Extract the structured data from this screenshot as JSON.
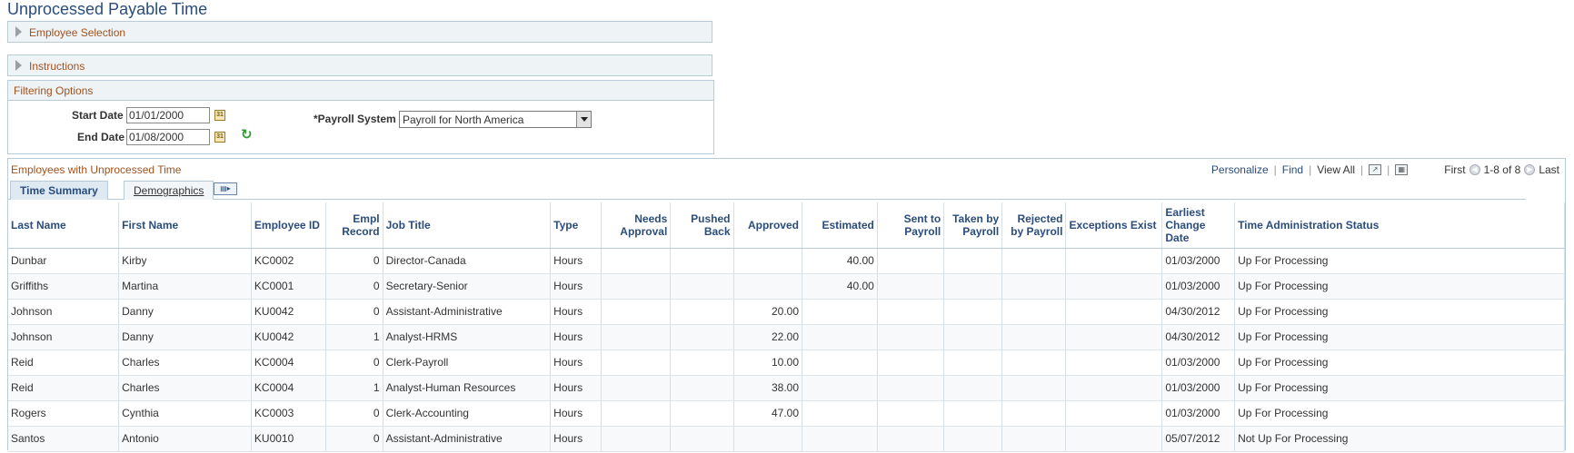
{
  "page": {
    "title": "Unprocessed Payable Time"
  },
  "sections": {
    "employee_selection": "Employee Selection",
    "instructions": "Instructions"
  },
  "filter": {
    "header": "Filtering Options",
    "start_date_label": "Start Date",
    "start_date": "01/01/2000",
    "end_date_label": "End Date",
    "end_date": "01/08/2000",
    "payroll_label": "*Payroll System",
    "payroll_value": "Payroll for North America"
  },
  "grid": {
    "title": "Employees with Unprocessed Time",
    "nav": {
      "personalize": "Personalize",
      "find": "Find",
      "view_all": "View All",
      "first": "First",
      "range": "1-8 of 8",
      "last": "Last"
    },
    "tabs": [
      "Time Summary",
      "Demographics"
    ],
    "columns": [
      "Last Name",
      "First Name",
      "Employee ID",
      "Empl Record",
      "Job Title",
      "Type",
      "Needs Approval",
      "Pushed Back",
      "Approved",
      "Estimated",
      "Sent to Payroll",
      "Taken by Payroll",
      "Rejected by Payroll",
      "Exceptions Exist",
      "Earliest Change Date",
      "Time Administration Status"
    ],
    "rows": [
      [
        "Dunbar",
        "Kirby",
        "KC0002",
        "0",
        "Director-Canada",
        "Hours",
        "",
        "",
        "",
        "40.00",
        "",
        "",
        "",
        "",
        "01/03/2000",
        "Up For Processing"
      ],
      [
        "Griffiths",
        "Martina",
        "KC0001",
        "0",
        "Secretary-Senior",
        "Hours",
        "",
        "",
        "",
        "40.00",
        "",
        "",
        "",
        "",
        "01/03/2000",
        "Up For Processing"
      ],
      [
        "Johnson",
        "Danny",
        "KU0042",
        "0",
        "Assistant-Administrative",
        "Hours",
        "",
        "",
        "20.00",
        "",
        "",
        "",
        "",
        "",
        "04/30/2012",
        "Up For Processing"
      ],
      [
        "Johnson",
        "Danny",
        "KU0042",
        "1",
        "Analyst-HRMS",
        "Hours",
        "",
        "",
        "22.00",
        "",
        "",
        "",
        "",
        "",
        "04/30/2012",
        "Up For Processing"
      ],
      [
        "Reid",
        "Charles",
        "KC0004",
        "0",
        "Clerk-Payroll",
        "Hours",
        "",
        "",
        "10.00",
        "",
        "",
        "",
        "",
        "",
        "01/03/2000",
        "Up For Processing"
      ],
      [
        "Reid",
        "Charles",
        "KC0004",
        "1",
        "Analyst-Human Resources",
        "Hours",
        "",
        "",
        "38.00",
        "",
        "",
        "",
        "",
        "",
        "01/03/2000",
        "Up For Processing"
      ],
      [
        "Rogers",
        "Cynthia",
        "KC0003",
        "0",
        "Clerk-Accounting",
        "Hours",
        "",
        "",
        "47.00",
        "",
        "",
        "",
        "",
        "",
        "01/03/2000",
        "Up For Processing"
      ],
      [
        "Santos",
        "Antonio",
        "KU0010",
        "0",
        "Assistant-Administrative",
        "Hours",
        "",
        "",
        "",
        "",
        "",
        "",
        "",
        "",
        "05/07/2012",
        "Not Up For Processing"
      ]
    ]
  }
}
